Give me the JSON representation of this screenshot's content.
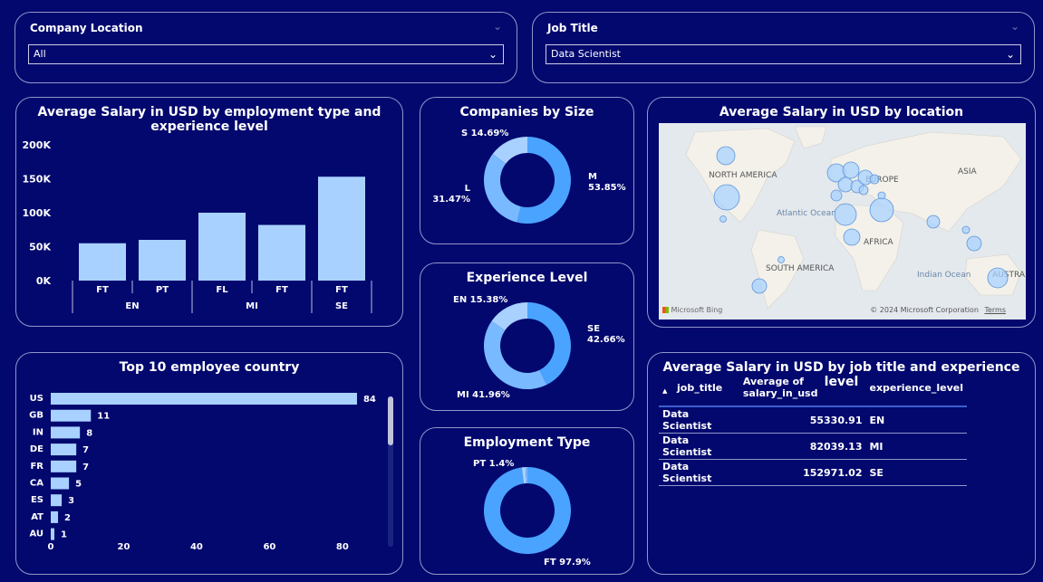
{
  "slicers": {
    "company_location": {
      "label": "Company Location",
      "value": "All"
    },
    "job_title": {
      "label": "Job Title",
      "value": "Data Scientist"
    }
  },
  "salary_by_type": {
    "title": "Average Salary in USD by employment type and experience level",
    "chart_data": {
      "type": "bar",
      "categories": [
        "EN FT",
        "EN PT",
        "MI FL",
        "MI FT",
        "SE FT"
      ],
      "groups": [
        {
          "label": "EN",
          "items": [
            "FT",
            "PT"
          ]
        },
        {
          "label": "MI",
          "items": [
            "FL",
            "FT"
          ]
        },
        {
          "label": "SE",
          "items": [
            "FT"
          ]
        }
      ],
      "values": [
        55000,
        60000,
        100000,
        82000,
        153000
      ],
      "ylim": [
        0,
        200000
      ],
      "yticks": [
        "0K",
        "50K",
        "100K",
        "150K",
        "200K"
      ],
      "color": "#a9d1ff"
    }
  },
  "companies_by_size": {
    "title": "Companies by Size",
    "chart_data": {
      "type": "pie",
      "slices": [
        {
          "label": "M",
          "pct": "53.85%",
          "value": 53.85,
          "color": "#4aa3ff"
        },
        {
          "label": "L",
          "pct": "31.47%",
          "value": 31.47,
          "color": "#79b9ff"
        },
        {
          "label": "S",
          "pct": "14.69%",
          "value": 14.69,
          "color": "#a9d1ff"
        }
      ]
    }
  },
  "experience_level": {
    "title": "Experience Level",
    "chart_data": {
      "type": "pie",
      "slices": [
        {
          "label": "SE",
          "pct": "42.66%",
          "value": 42.66,
          "color": "#4aa3ff"
        },
        {
          "label": "MI",
          "pct": "41.96%",
          "value": 41.96,
          "color": "#79b9ff"
        },
        {
          "label": "EN",
          "pct": "15.38%",
          "value": 15.38,
          "color": "#a9d1ff"
        }
      ]
    }
  },
  "employment_type": {
    "title": "Employment Type",
    "chart_data": {
      "type": "pie",
      "slices": [
        {
          "label": "FT",
          "pct": "97.9%",
          "value": 97.9,
          "color": "#4aa3ff"
        },
        {
          "label": "PT",
          "pct": "1.4%",
          "value": 1.4,
          "color": "#a9d1ff"
        },
        {
          "label": "",
          "pct": "",
          "value": 0.7,
          "color": "#79b9ff"
        }
      ]
    }
  },
  "map_card": {
    "title": "Average Salary in USD by location",
    "labels": [
      "NORTH AMERICA",
      "EUROPE",
      "ASIA",
      "Atlantic Ocean",
      "AFRICA",
      "SOUTH AMERICA",
      "Indian Ocean",
      "AUSTRA"
    ],
    "bing": "Microsoft Bing",
    "copyright": "© 2024 Microsoft Corporation",
    "terms": "Terms",
    "bubble_color": "#a9d1ff"
  },
  "top_countries": {
    "title": "Top 10 employee country",
    "chart_data": {
      "type": "bar",
      "orientation": "horizontal",
      "categories": [
        "US",
        "GB",
        "IN",
        "DE",
        "FR",
        "CA",
        "ES",
        "AT",
        "AU"
      ],
      "values": [
        84,
        11,
        8,
        7,
        7,
        5,
        3,
        2,
        1
      ],
      "xlim": [
        0,
        85
      ],
      "xticks": [
        "0",
        "20",
        "40",
        "60",
        "80"
      ],
      "color": "#a9d1ff"
    }
  },
  "salary_table": {
    "title": "Average Salary in USD by job title and experience level",
    "columns": [
      "job_title",
      "Average of salary_in_usd",
      "experience_level"
    ],
    "rows": [
      [
        "Data Scientist",
        "55330.91",
        "EN"
      ],
      [
        "Data Scientist",
        "82039.13",
        "MI"
      ],
      [
        "Data Scientist",
        "152971.02",
        "SE"
      ]
    ]
  }
}
